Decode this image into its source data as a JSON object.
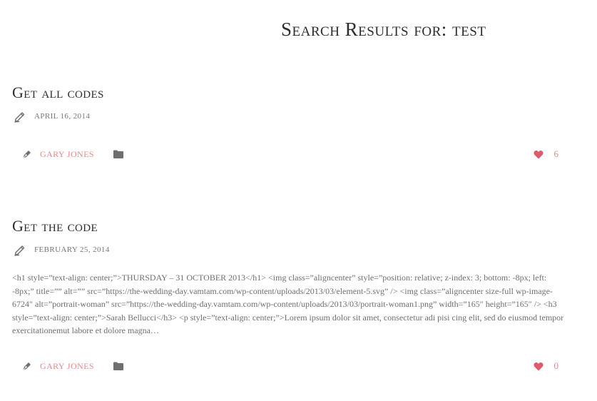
{
  "page": {
    "title": "Search Results for: test"
  },
  "colors": {
    "accent": "#e8898a",
    "heart": "#e05a6a",
    "icon_gray": "#6f6f6f",
    "text": "#2d2d2d"
  },
  "posts": [
    {
      "title": "Get all codes",
      "date": "April 16, 2014",
      "date_icon": "pencil-icon",
      "excerpt": "",
      "author": "Gary Jones",
      "author_icon": "pen-nib-icon",
      "category_icon": "folder-icon",
      "likes": "6",
      "likes_icon": "heart-icon"
    },
    {
      "title": "Get the code",
      "date": "February 25, 2014",
      "date_icon": "pencil-icon",
      "excerpt": "<h1 style=”text-align: center;”>THURSDAY – 31 OCTOBER 2013</h1> <img class=”aligncenter” style=”position: relative; z-index: 3; bottom: -8px; left: -8px;” title=”” alt=”” src=”https://the-wedding-day.vamtam.com/wp-content/uploads/2013/03/element-5.svg” /> <img class=”aligncenter size-full wp-image-6724″ alt=”portrait-woman” src=”https://the-wedding-day.vamtam.com/wp-content/uploads/2013/03/portrait-woman1.png” width=”165″ height=”165″ /> <h3 style=”text-align: center;”>Sarah Bellucci</h3> <p style=”text-align: center;”>Lorem ipsum dolor sit amet, consectetur adi pisi cing elit, sed do eiusmod tempor exercitationemut labore et dolore magna…",
      "author": "Gary Jones",
      "author_icon": "pen-nib-icon",
      "category_icon": "folder-icon",
      "likes": "0",
      "likes_icon": "heart-icon"
    }
  ]
}
